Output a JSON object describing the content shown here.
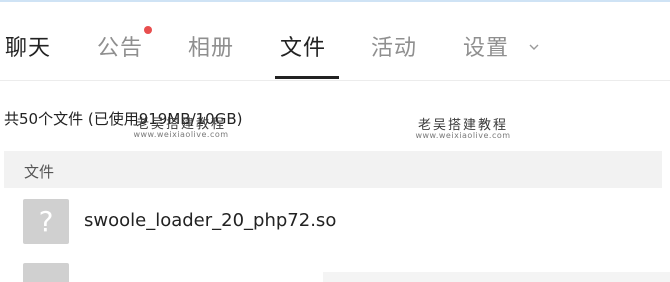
{
  "tabs": [
    {
      "label": "聊天",
      "active": false
    },
    {
      "label": "公告",
      "has_notification": true
    },
    {
      "label": "相册"
    },
    {
      "label": "文件",
      "active": true
    },
    {
      "label": "活动"
    },
    {
      "label": "设置",
      "icon": "chevron-down-icon"
    }
  ],
  "summary": "共50个文件 (已使用919MB/10GB)",
  "watermarks": [
    {
      "title": "老吴搭建教程",
      "url": "www.weixiaolive.com"
    },
    {
      "title": "老吴搭建教程",
      "url": "www.weixiaolive.com"
    }
  ],
  "table": {
    "header": "文件",
    "rows": [
      {
        "icon": "unknown-file-icon",
        "icon_glyph": "?",
        "name": "swoole_loader_20_php72.so"
      }
    ]
  },
  "colors": {
    "active_text": "#222222",
    "inactive_text": "#8f8f8f",
    "notification_dot": "#e84e4e",
    "header_bg": "#f2f2f2",
    "file_icon_bg": "#d0d0d0"
  }
}
